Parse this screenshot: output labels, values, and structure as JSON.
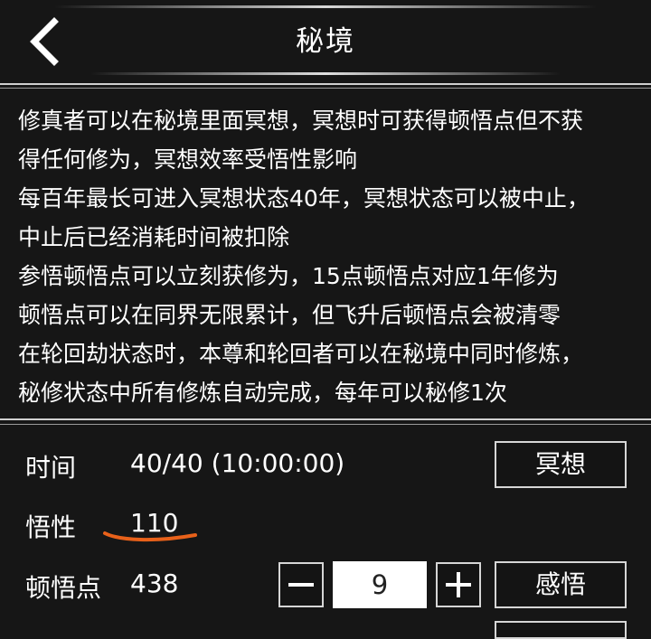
{
  "header": {
    "title": "秘境",
    "back_icon": "chevron-left-icon"
  },
  "description": [
    "修真者可以在秘境里面冥想，冥想时可获得顿悟点但不获",
    "得任何修为，冥想效率受悟性影响",
    "每百年最长可进入冥想状态40年，冥想状态可以被中止，",
    "中止后已经消耗时间被扣除",
    "参悟顿悟点可以立刻获修为，15点顿悟点对应1年修为",
    "顿悟点可以在同界无限累计，但飞升后顿悟点会被清零",
    "在轮回劫状态时，本尊和轮回者可以在秘境中同时修炼，",
    "秘修状态中所有修炼自动完成，每年可以秘修1次"
  ],
  "stats": {
    "time": {
      "label": "时间",
      "value": "40/40 (10:00:00)",
      "button": "冥想"
    },
    "wisdom": {
      "label": "悟性",
      "value": "110"
    },
    "insight": {
      "label": "顿悟点",
      "value": "438",
      "quantity": "9",
      "button": "感悟"
    }
  },
  "colors": {
    "background": "#161616",
    "annotation": "#e8611a",
    "border": "#d6d6d6"
  }
}
